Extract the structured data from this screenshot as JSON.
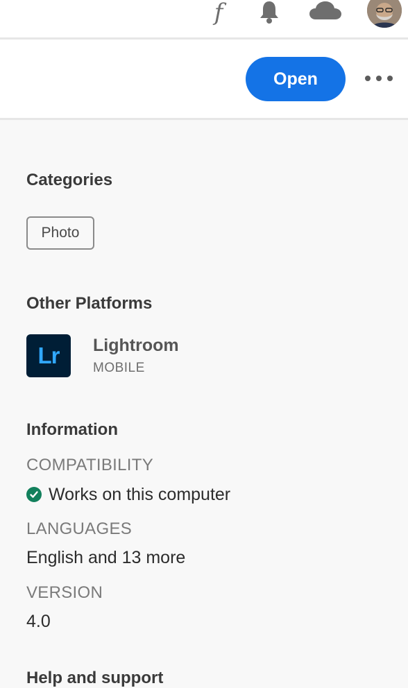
{
  "header": {
    "font_icon_glyph": "f",
    "icons": [
      "fonts-icon",
      "bell-icon",
      "cloud-icon",
      "avatar"
    ]
  },
  "actions": {
    "open_label": "Open",
    "more_icon": "more-icon"
  },
  "categories": {
    "title": "Categories",
    "items": [
      "Photo"
    ]
  },
  "other_platforms": {
    "title": "Other Platforms",
    "app": {
      "icon_text": "Lr",
      "name": "Lightroom",
      "platform": "MOBILE"
    }
  },
  "information": {
    "title": "Information",
    "compatibility_label": "COMPATIBILITY",
    "compatibility_value": "Works on this computer",
    "languages_label": "LANGUAGES",
    "languages_value": "English and 13 more",
    "version_label": "VERSION",
    "version_value": "4.0"
  },
  "help": {
    "title": "Help and support"
  },
  "colors": {
    "accent": "#1473e6",
    "lr_bg": "#001e36",
    "lr_fg": "#31a8ff",
    "success": "#12805c"
  }
}
